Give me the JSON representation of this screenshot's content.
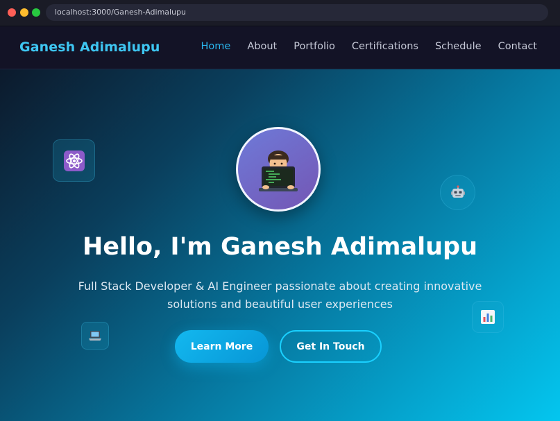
{
  "browser": {
    "url": "localhost:3000/Ganesh-Adimalupu"
  },
  "nav": {
    "brand": "Ganesh Adimalupu",
    "items": [
      {
        "label": "Home",
        "active": true
      },
      {
        "label": "About",
        "active": false
      },
      {
        "label": "Portfolio",
        "active": false
      },
      {
        "label": "Certifications",
        "active": false
      },
      {
        "label": "Schedule",
        "active": false
      },
      {
        "label": "Contact",
        "active": false
      }
    ]
  },
  "hero": {
    "title": "Hello, I'm Ganesh Adimalupu",
    "subtitle": "Full Stack Developer & AI Engineer passionate about creating innovative solutions and beautiful user experiences",
    "primary_button": "Learn More",
    "secondary_button": "Get In Touch",
    "avatar_icon": "technologist-icon",
    "floating_icons": [
      "atom-icon",
      "robot-icon",
      "bar-chart-icon",
      "laptop-icon"
    ]
  },
  "colors": {
    "accent": "#2ab7ee",
    "button_primary": "#13b8ef",
    "button_outline": "#1ad0ff"
  }
}
